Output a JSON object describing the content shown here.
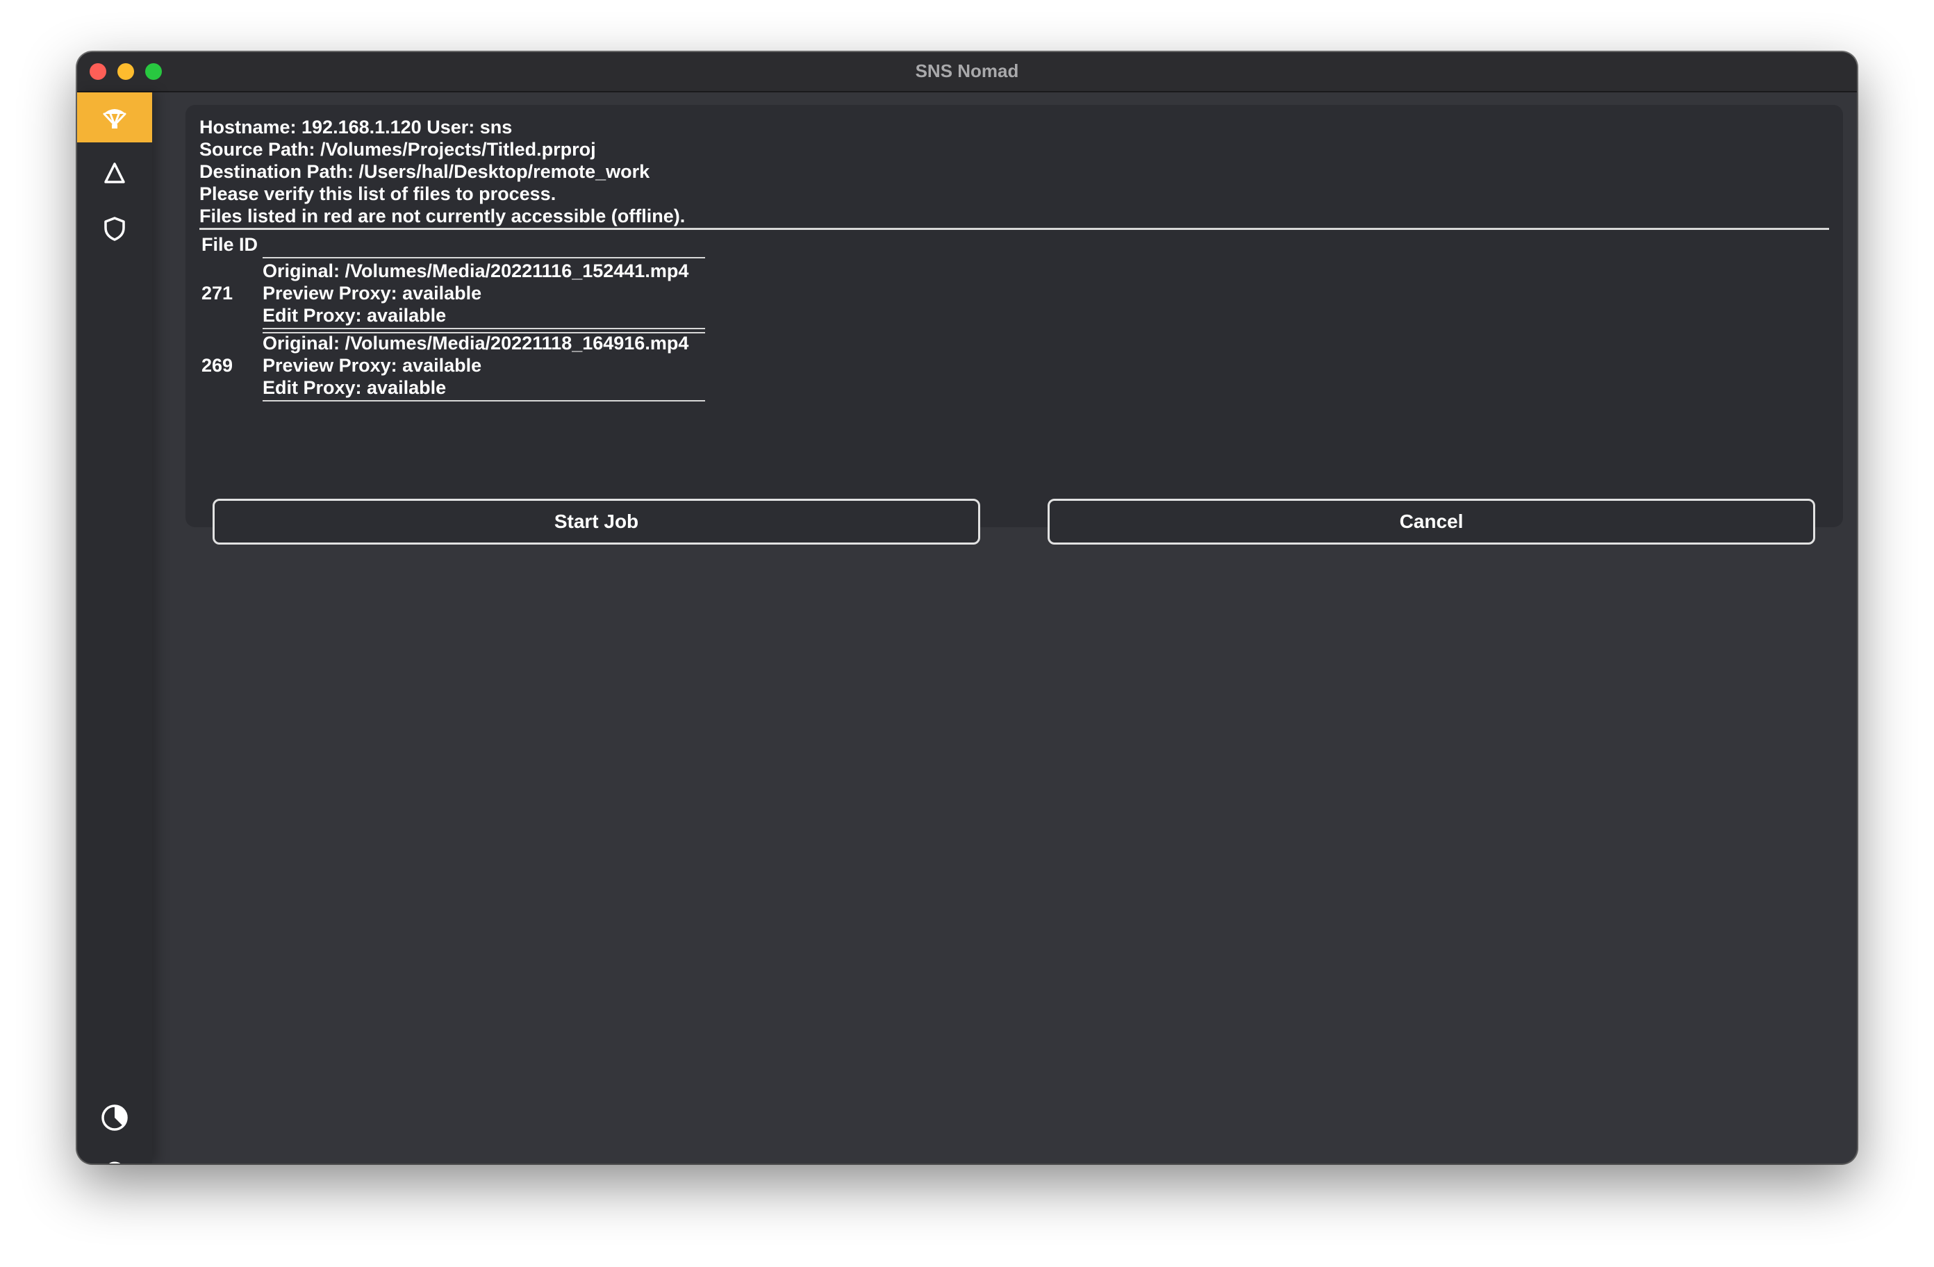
{
  "window": {
    "title": "SNS Nomad"
  },
  "sidebar": {
    "items": [
      {
        "icon": "parachute-icon",
        "active": true
      },
      {
        "icon": "delta-icon",
        "active": false
      },
      {
        "icon": "shield-icon",
        "active": false
      }
    ],
    "bottom_items": [
      {
        "icon": "appearance-icon"
      },
      {
        "icon": "help-icon",
        "glyph": "?"
      }
    ],
    "active_color": "#f5b335"
  },
  "summary": {
    "hostname_line": "Hostname: 192.168.1.120 User: sns",
    "source_line": "Source Path: /Volumes/Projects/Titled.prproj",
    "destination_line": "Destination Path: /Users/hal/Desktop/remote_work",
    "verify_line": "Please verify this list of files to process.",
    "offline_line": "Files listed in red are not currently accessible (offline)."
  },
  "file_table": {
    "header": "File ID",
    "rows": [
      {
        "id": "271",
        "original": "Original: /Volumes/Media/20221116_152441.mp4",
        "preview": "Preview Proxy: available",
        "edit": "Edit Proxy: available"
      },
      {
        "id": "269",
        "original": "Original: /Volumes/Media/20221118_164916.mp4",
        "preview": "Preview Proxy: available",
        "edit": "Edit Proxy: available"
      }
    ]
  },
  "actions": {
    "start_label": "Start Job",
    "cancel_label": "Cancel"
  }
}
